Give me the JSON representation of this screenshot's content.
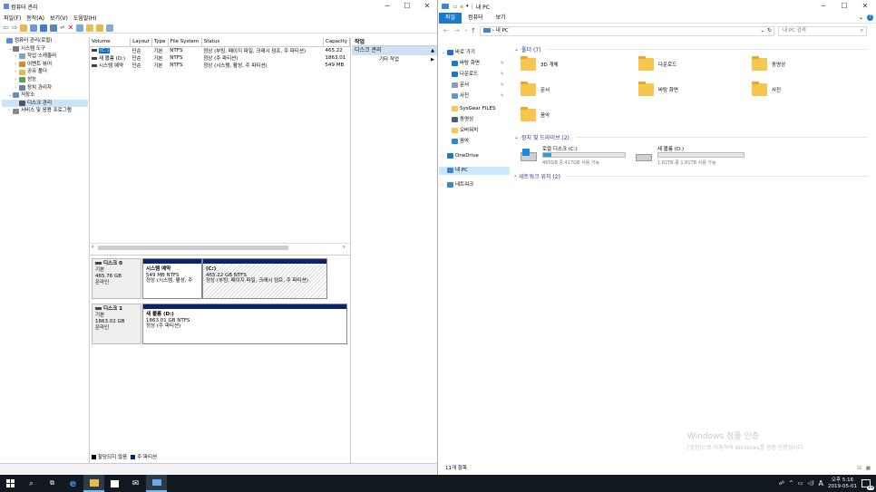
{
  "cm": {
    "title": "컴퓨터 관리",
    "menu": [
      "파일(F)",
      "동작(A)",
      "보기(V)",
      "도움말(H)"
    ],
    "tree": [
      {
        "label": "컴퓨터 관리(로컬)",
        "indent": 0,
        "icon": "computer-management-icon"
      },
      {
        "label": "시스템 도구",
        "indent": 1,
        "icon": "tools-icon"
      },
      {
        "label": "작업 스케줄러",
        "indent": 2,
        "icon": "clock-icon"
      },
      {
        "label": "이벤트 뷰어",
        "indent": 2,
        "icon": "event-viewer-icon"
      },
      {
        "label": "공유 폴더",
        "indent": 2,
        "icon": "shared-folder-icon"
      },
      {
        "label": "성능",
        "indent": 2,
        "icon": "performance-icon"
      },
      {
        "label": "장치 관리자",
        "indent": 2,
        "icon": "device-manager-icon"
      },
      {
        "label": "저장소",
        "indent": 1,
        "icon": "storage-icon"
      },
      {
        "label": "디스크 관리",
        "indent": 2,
        "icon": "disk-icon",
        "selected": true
      },
      {
        "label": "서비스 및 응용 프로그램",
        "indent": 1,
        "icon": "services-icon"
      }
    ],
    "columns": [
      "Volume",
      "Layout",
      "Type",
      "File System",
      "Status",
      "Capacity"
    ],
    "volumes": [
      {
        "volume": "(C:)",
        "layout": "단순",
        "type": "기본",
        "fs": "NTFS",
        "status": "정상 (부팅, 페이지 파일, 크래시 덤프, 주 파티션)",
        "capacity": "465.22"
      },
      {
        "volume": "새 볼륨 (D:)",
        "layout": "단순",
        "type": "기본",
        "fs": "NTFS",
        "status": "정상 (주 파티션)",
        "capacity": "1863.01"
      },
      {
        "volume": "시스템 예약",
        "layout": "단순",
        "type": "기본",
        "fs": "NTFS",
        "status": "정상 (시스템, 활성, 주 파티션)",
        "capacity": "549 MB"
      }
    ],
    "actions": {
      "header": "작업",
      "item": "디스크 관리",
      "sub": "기타 작업"
    },
    "disk0": {
      "name": "디스크 0",
      "type": "기본",
      "size": "465.76 GB",
      "state": "온라인",
      "p1": {
        "name": "시스템 예약",
        "size": "549 MB NTFS",
        "status": "정상 (시스템, 활성, 주"
      },
      "p2": {
        "name": "(C:)",
        "size": "465.22 GB NTFS",
        "status": "정상 (부팅, 페이지 파일, 크래시 덤프, 주 파티션)"
      }
    },
    "disk1": {
      "name": "디스크 1",
      "type": "기본",
      "size": "1863.02 GB",
      "state": "온라인",
      "p1": {
        "name": "새 볼륨 (D:)",
        "size": "1863.01 GB NTFS",
        "status": "정상 (주 파티션)"
      }
    },
    "legend": [
      "할당되지 않음",
      "주 파티션"
    ]
  },
  "ex": {
    "title": "내 PC",
    "tabs": [
      "파일",
      "컴퓨터",
      "보기"
    ],
    "address": "내 PC",
    "search_placeholder": "내 PC 검색",
    "nav": [
      {
        "label": "바로 가기",
        "icon": "star-icon",
        "indent": 0
      },
      {
        "label": "바탕 화면",
        "icon": "desktop-icon",
        "indent": 1,
        "pin": true
      },
      {
        "label": "다운로드",
        "icon": "download-icon",
        "indent": 1,
        "pin": true
      },
      {
        "label": "문서",
        "icon": "document-icon",
        "indent": 1,
        "pin": true
      },
      {
        "label": "사진",
        "icon": "picture-icon",
        "indent": 1,
        "pin": true
      },
      {
        "label": "SysGear FILES",
        "icon": "folder-icon",
        "indent": 1
      },
      {
        "label": "동영상",
        "icon": "video-icon",
        "indent": 1
      },
      {
        "label": "오버워치",
        "icon": "folder-icon",
        "indent": 1
      },
      {
        "label": "음악",
        "icon": "music-icon",
        "indent": 1
      },
      {
        "label": "OneDrive",
        "icon": "onedrive-icon",
        "indent": 0
      },
      {
        "label": "내 PC",
        "icon": "pc-icon",
        "indent": 0,
        "selected": true
      },
      {
        "label": "네트워크",
        "icon": "network-icon",
        "indent": 0
      }
    ],
    "folders_header": "폴더 (7)",
    "folders": [
      "3D 개체",
      "다운로드",
      "동영상",
      "문서",
      "바탕 화면",
      "사진",
      "음악"
    ],
    "drives_header": "장치 및 드라이브 (2)",
    "drives": [
      {
        "name": "로컬 디스크 (C:)",
        "info": "465GB 중 417GB 사용 가능",
        "used_fraction": 0.1
      },
      {
        "name": "새 볼륨 (D:)",
        "info": "1.81TB 중 1.81TB 사용 가능",
        "used_fraction": 0.0
      }
    ],
    "network_header": "네트워크 위치 (2)",
    "status": "11개 항목",
    "watermark_title": "Windows 정품 인증",
    "watermark_sub": "[설정]으로 이동하여 Windows를 정품 인증합니다."
  },
  "taskbar": {
    "time": "오후 5:16",
    "date": "2019-05-01",
    "ime": "A",
    "notif": "18"
  }
}
